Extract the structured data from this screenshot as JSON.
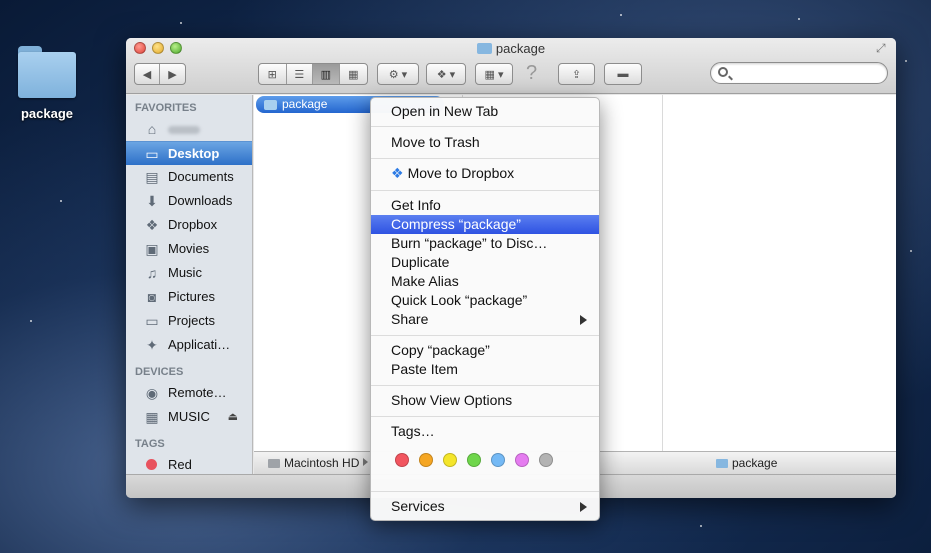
{
  "desktop": {
    "icon_label": "package"
  },
  "window": {
    "title": "package",
    "sidebar": {
      "favorites_header": "FAVORITES",
      "favorites": [
        {
          "label": "",
          "icon": "home-icon"
        },
        {
          "label": "Desktop",
          "icon": "desktop-icon"
        },
        {
          "label": "Documents",
          "icon": "documents-icon"
        },
        {
          "label": "Downloads",
          "icon": "downloads-icon"
        },
        {
          "label": "Dropbox",
          "icon": "dropbox-icon"
        },
        {
          "label": "Movies",
          "icon": "movies-icon"
        },
        {
          "label": "Music",
          "icon": "music-icon"
        },
        {
          "label": "Pictures",
          "icon": "pictures-icon"
        },
        {
          "label": "Projects",
          "icon": "folder-icon"
        },
        {
          "label": "Applicati…",
          "icon": "applications-icon"
        }
      ],
      "devices_header": "DEVICES",
      "devices": [
        {
          "label": "Remote…",
          "icon": "remote-disc-icon"
        },
        {
          "label": "MUSIC",
          "icon": "drive-icon"
        }
      ],
      "tags_header": "TAGS",
      "tags": [
        {
          "label": "Red",
          "color": "#e8525e"
        }
      ]
    },
    "selected_item": "package",
    "pathbar": {
      "disk": "Macintosh HD",
      "current": "package"
    }
  },
  "context_menu": {
    "items": {
      "open_new_tab": "Open in New Tab",
      "move_to_trash": "Move to Trash",
      "move_to_dropbox": "Move to Dropbox",
      "get_info": "Get Info",
      "compress": "Compress “package”",
      "burn": "Burn “package” to Disc…",
      "duplicate": "Duplicate",
      "make_alias": "Make Alias",
      "quick_look": "Quick Look “package”",
      "share": "Share",
      "copy": "Copy “package”",
      "paste": "Paste Item",
      "show_view_options": "Show View Options",
      "tags": "Tags…",
      "services": "Services"
    },
    "highlighted": "compress",
    "tag_colors": [
      "#f2555f",
      "#f5a623",
      "#f4e52a",
      "#6fd64b",
      "#74b9f5",
      "#e57cf0",
      "#b3b3b3"
    ]
  },
  "colors": {
    "selection_blue": "#2d70c8",
    "menu_highlight": "#2e52e2"
  }
}
